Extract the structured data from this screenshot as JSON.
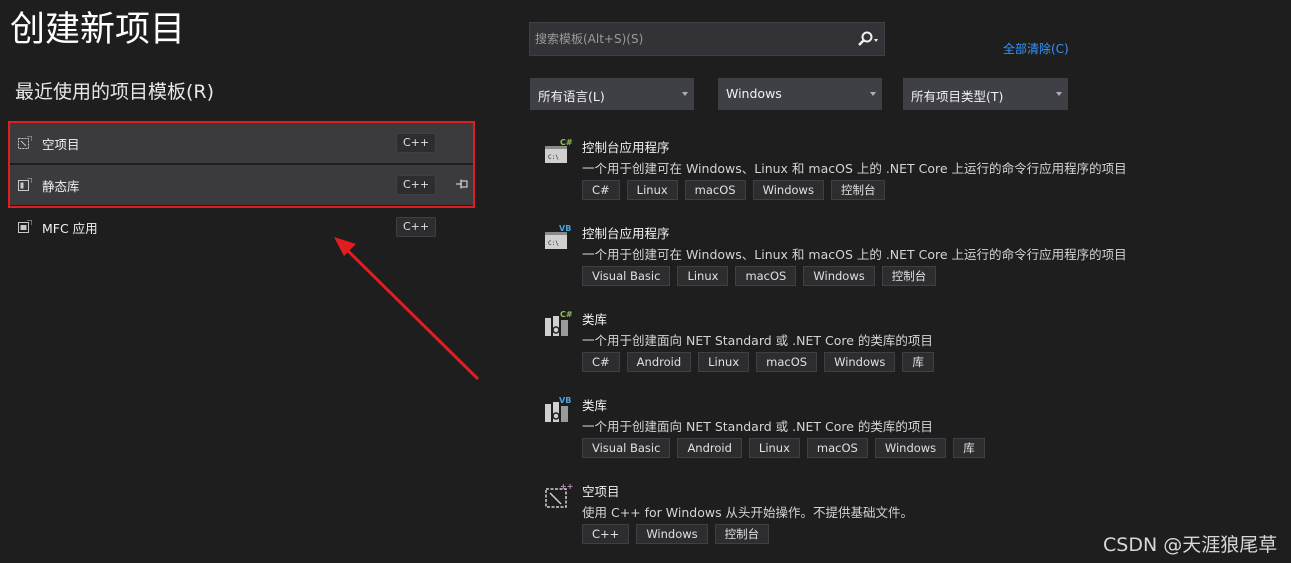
{
  "page_title": "创建新项目",
  "recent": {
    "title": "最近使用的项目模板(R)",
    "items": [
      {
        "label": "空项目",
        "badge": "C++"
      },
      {
        "label": "静态库",
        "badge": "C++"
      },
      {
        "label": "MFC 应用",
        "badge": "C++"
      }
    ]
  },
  "search": {
    "placeholder": "搜索模板(Alt+S)(S)"
  },
  "clear_all": "全部清除(C)",
  "filters": {
    "language": "所有语言(L)",
    "platform": "Windows",
    "project_type": "所有项目类型(T)"
  },
  "templates": [
    {
      "name": "控制台应用程序",
      "icon_badge": "C#",
      "description": "一个用于创建可在 Windows、Linux 和 macOS 上的 .NET Core 上运行的命令行应用程序的项目",
      "tags": [
        "C#",
        "Linux",
        "macOS",
        "Windows",
        "控制台"
      ]
    },
    {
      "name": "控制台应用程序",
      "icon_badge": "VB",
      "description": "一个用于创建可在 Windows、Linux 和 macOS 上的 .NET Core 上运行的命令行应用程序的项目",
      "tags": [
        "Visual Basic",
        "Linux",
        "macOS",
        "Windows",
        "控制台"
      ]
    },
    {
      "name": "类库",
      "icon_badge": "C#",
      "description": "一个用于创建面向 NET Standard 或 .NET Core 的类库的项目",
      "tags": [
        "C#",
        "Android",
        "Linux",
        "macOS",
        "Windows",
        "库"
      ]
    },
    {
      "name": "类库",
      "icon_badge": "VB",
      "description": "一个用于创建面向 NET Standard 或 .NET Core 的类库的项目",
      "tags": [
        "Visual Basic",
        "Android",
        "Linux",
        "macOS",
        "Windows",
        "库"
      ]
    },
    {
      "name": "空项目",
      "icon_badge": "++",
      "description": "使用 C++ for Windows 从头开始操作。不提供基础文件。",
      "tags": [
        "C++",
        "Windows",
        "控制台"
      ]
    }
  ],
  "colors": {
    "background": "#1e1e1e",
    "accent_link": "#3794ff",
    "highlight": "#e01e22",
    "badge_csharp": "#8fc35a",
    "badge_vb": "#4aa3df",
    "badge_cpp": "#c586c0"
  },
  "watermark": "CSDN @天涯狼尾草"
}
